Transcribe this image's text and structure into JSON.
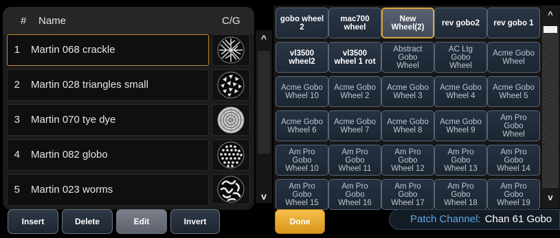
{
  "list": {
    "header": {
      "num": "#",
      "name": "Name",
      "cg": "C/G"
    },
    "rows": [
      {
        "num": "1",
        "name": "Martin 068 crackle",
        "selected": true,
        "gobo": "crackle-gobo-icon"
      },
      {
        "num": "2",
        "name": "Martin 028 triangles small",
        "selected": false,
        "gobo": "triangles-gobo-icon"
      },
      {
        "num": "3",
        "name": "Martin 070 tye dye",
        "selected": false,
        "gobo": "tye-dye-gobo-icon"
      },
      {
        "num": "4",
        "name": "Martin 082 globo",
        "selected": false,
        "gobo": "globo-gobo-icon"
      },
      {
        "num": "5",
        "name": "Martin 023 worms",
        "selected": false,
        "gobo": "worms-gobo-icon"
      }
    ],
    "scroll": {
      "up": "^",
      "down": "v"
    }
  },
  "grid": {
    "cells": [
      {
        "label": "gobo wheel\n2",
        "style": "bold"
      },
      {
        "label": "mac700\nwheel",
        "style": "bold"
      },
      {
        "label": "New\nWheel(2)",
        "style": "newwheel"
      },
      {
        "label": "rev gobo2",
        "style": "bold"
      },
      {
        "label": "rev gobo 1",
        "style": "bold"
      },
      {
        "label": "vl3500\nwheel2",
        "style": "bold"
      },
      {
        "label": "vl3500\nwheel 1 rot",
        "style": "bold"
      },
      {
        "label": "Abstract\nGobo\nWheel",
        "style": "normal"
      },
      {
        "label": "AC Ltg\nGobo\nWheel",
        "style": "normal"
      },
      {
        "label": "Acme Gobo\nWheel",
        "style": "normal"
      },
      {
        "label": "Acme Gobo\nWheel 10",
        "style": "normal"
      },
      {
        "label": "Acme Gobo\nWheel 2",
        "style": "normal"
      },
      {
        "label": "Acme Gobo\nWheel 3",
        "style": "normal"
      },
      {
        "label": "Acme Gobo\nWheel 4",
        "style": "normal"
      },
      {
        "label": "Acme Gobo\nWheel 5",
        "style": "normal"
      },
      {
        "label": "Acme Gobo\nWheel 6",
        "style": "normal"
      },
      {
        "label": "Acme Gobo\nWheel 7",
        "style": "normal"
      },
      {
        "label": "Acme Gobo\nWheel 8",
        "style": "normal"
      },
      {
        "label": "Acme Gobo\nWheel 9",
        "style": "normal"
      },
      {
        "label": "Am Pro\nGobo\nWheel",
        "style": "normal"
      },
      {
        "label": "Am Pro\nGobo\nWheel 10",
        "style": "normal"
      },
      {
        "label": "Am Pro\nGobo\nWheel 11",
        "style": "normal"
      },
      {
        "label": "Am Pro\nGobo\nWheel 12",
        "style": "normal"
      },
      {
        "label": "Am Pro\nGobo\nWheel 13",
        "style": "normal"
      },
      {
        "label": "Am Pro\nGobo\nWheel 14",
        "style": "normal"
      },
      {
        "label": "Am Pro\nGobo\nWheel 15",
        "style": "normal"
      },
      {
        "label": "Am Pro\nGobo\nWheel 16",
        "style": "normal"
      },
      {
        "label": "Am Pro\nGobo\nWheel 17",
        "style": "normal"
      },
      {
        "label": "Am Pro\nGobo\nWheel 18",
        "style": "normal"
      },
      {
        "label": "Am Pro\nGobo\nWheel 19",
        "style": "normal"
      }
    ],
    "scroll": {
      "up": "^",
      "down": "v"
    }
  },
  "toolbar": {
    "insert": "Insert",
    "delete": "Delete",
    "edit": "Edit",
    "invert": "Invert",
    "done": "Done"
  },
  "patch": {
    "label": "Patch Channel:",
    "value": "Chan 61 Gobo"
  },
  "colors": {
    "accent": "#d9a43c",
    "selection": "#c08a2a",
    "patch_label": "#5aa9e6"
  }
}
